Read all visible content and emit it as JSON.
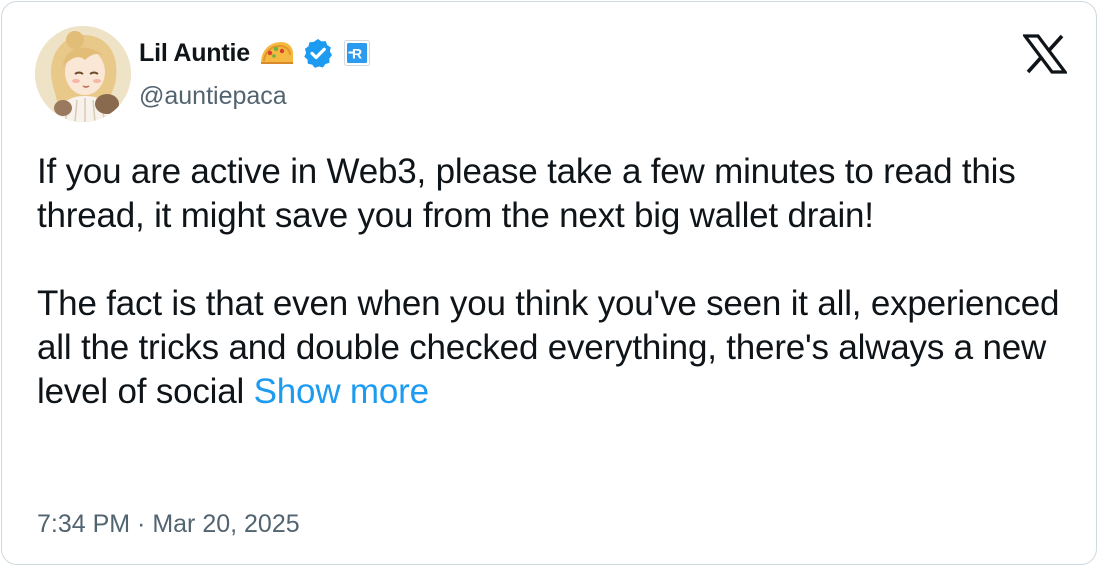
{
  "author": {
    "display_name": "Lil Auntie",
    "handle": "@auntiepaca",
    "emoji_icon": "taco-icon",
    "verified_icon": "verified-badge-icon",
    "affiliate_icon": "affiliate-badge-icon",
    "verified_color": "#1d9bf0"
  },
  "platform_icon": "x-logo-icon",
  "tweet": {
    "paragraph_1": "If you are active in Web3, please take a few minutes to read this thread, it might save you from the next big wallet drain!",
    "paragraph_2": "The fact is that even when you think you've seen it all, experienced all the tricks and double checked everything, there's always a new level of social",
    "show_more_label": "Show more"
  },
  "timestamp": "7:34 PM · Mar 20, 2025",
  "colors": {
    "link": "#1d9bf0",
    "secondary_text": "#536471",
    "primary_text": "#0f1419",
    "border": "#cfd9de"
  }
}
